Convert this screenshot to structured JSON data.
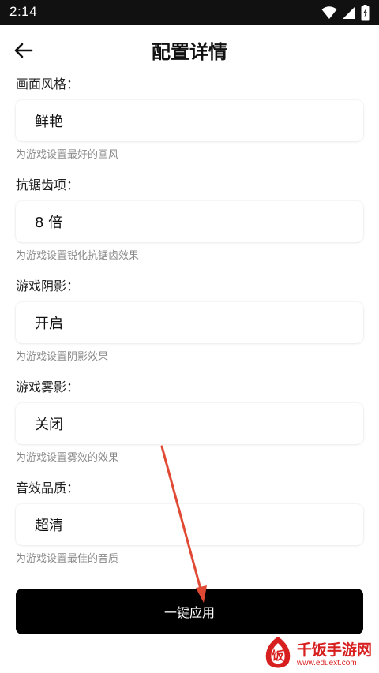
{
  "status_bar": {
    "time": "2:14",
    "icons": [
      "wifi-icon",
      "signal-icon",
      "battery-icon"
    ]
  },
  "header": {
    "title": "配置详情",
    "back_icon": "back-arrow-icon"
  },
  "settings": [
    {
      "label": "画面风格：",
      "value": "鲜艳",
      "hint": "为游戏设置最好的画风"
    },
    {
      "label": "抗锯齿项：",
      "value": "8 倍",
      "hint": "为游戏设置锐化抗锯齿效果"
    },
    {
      "label": "游戏阴影：",
      "value": "开启",
      "hint": "为游戏设置阴影效果"
    },
    {
      "label": "游戏雾影：",
      "value": "关闭",
      "hint": "为游戏设置雾效的效果"
    },
    {
      "label": "音效品质：",
      "value": "超清",
      "hint": "为游戏设置最佳的音质"
    }
  ],
  "apply_button": {
    "label": "一键应用"
  },
  "watermark": {
    "name": "千饭手游网",
    "url": "www.eduext.com",
    "logo_char": "饭"
  },
  "colors": {
    "status_bar_bg": "#111111",
    "button_bg": "#000000",
    "hint_text": "#8a8a8a",
    "annotation_arrow": "#e04a35",
    "watermark": "#d81f1f"
  }
}
